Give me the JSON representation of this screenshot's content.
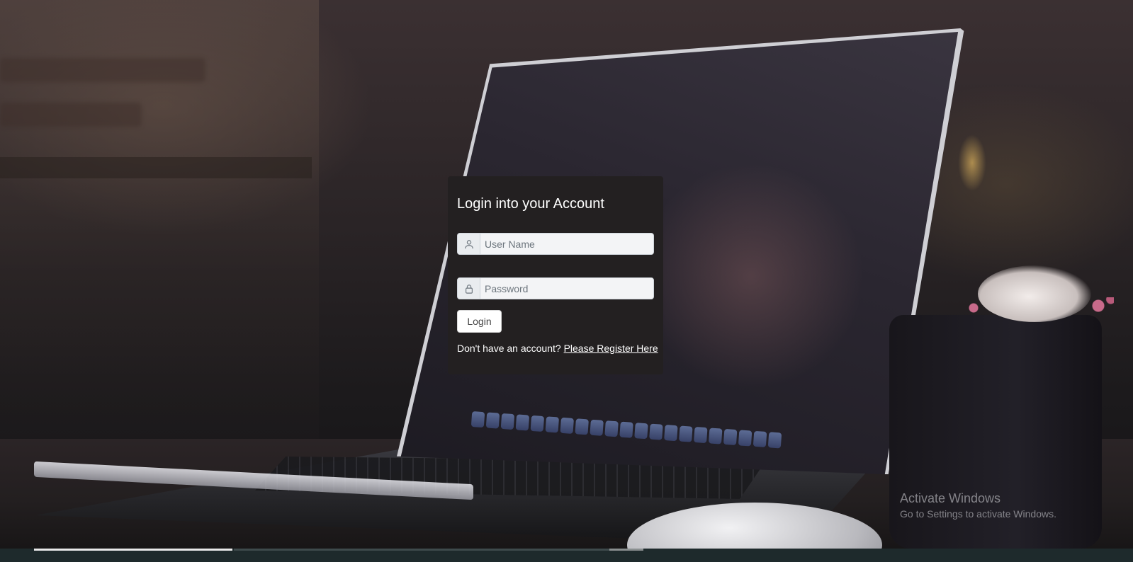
{
  "login": {
    "title": "Login into your Account",
    "username_placeholder": "User Name",
    "password_placeholder": "Password",
    "login_button": "Login",
    "register_prompt": "Don't have an account?",
    "register_link": "Please Register Here"
  },
  "watermark": {
    "title": "Activate Windows",
    "subtitle": "Go to Settings to activate Windows."
  },
  "icons": {
    "user": "user-icon",
    "lock": "lock-icon"
  },
  "colors": {
    "card_background": "#232021",
    "input_background": "#f3f4f6",
    "text": "#ffffff"
  }
}
